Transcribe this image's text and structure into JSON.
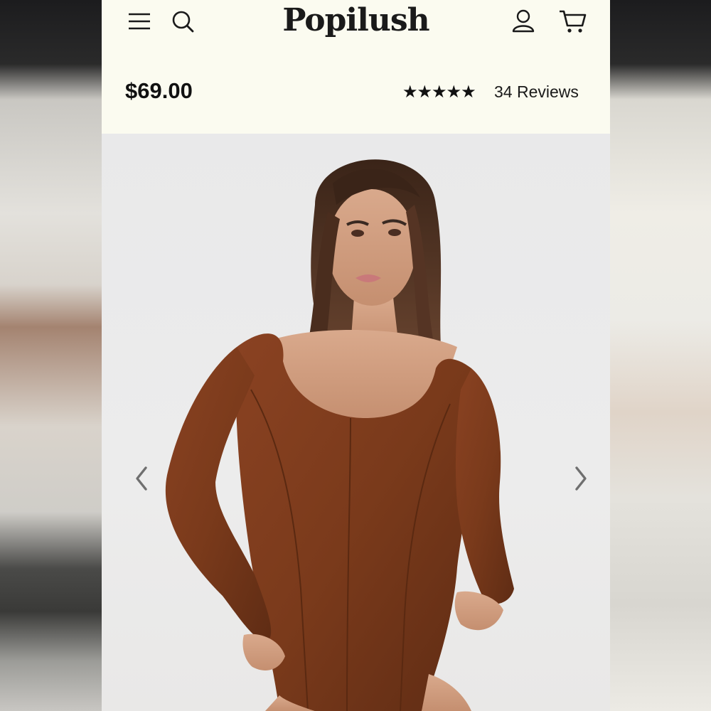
{
  "header": {
    "logo": "Popilush",
    "icons": [
      "menu-icon",
      "search-icon",
      "account-icon",
      "cart-icon"
    ]
  },
  "product": {
    "price": "$69.00",
    "rating_stars": "★★★★★",
    "rating_value": 4.5,
    "rating_max": 5,
    "reviews": "34 Reviews"
  },
  "gallery": {
    "image": "model-in-brown-long-sleeve-bodysuit",
    "prev_icon": "chevron-left-icon",
    "next_icon": "chevron-right-icon"
  },
  "colors": {
    "header_bg": "#fbfbf0",
    "gallery_bg": "#e9e9ea",
    "garment": "#7b3b1c",
    "text": "#111111"
  }
}
